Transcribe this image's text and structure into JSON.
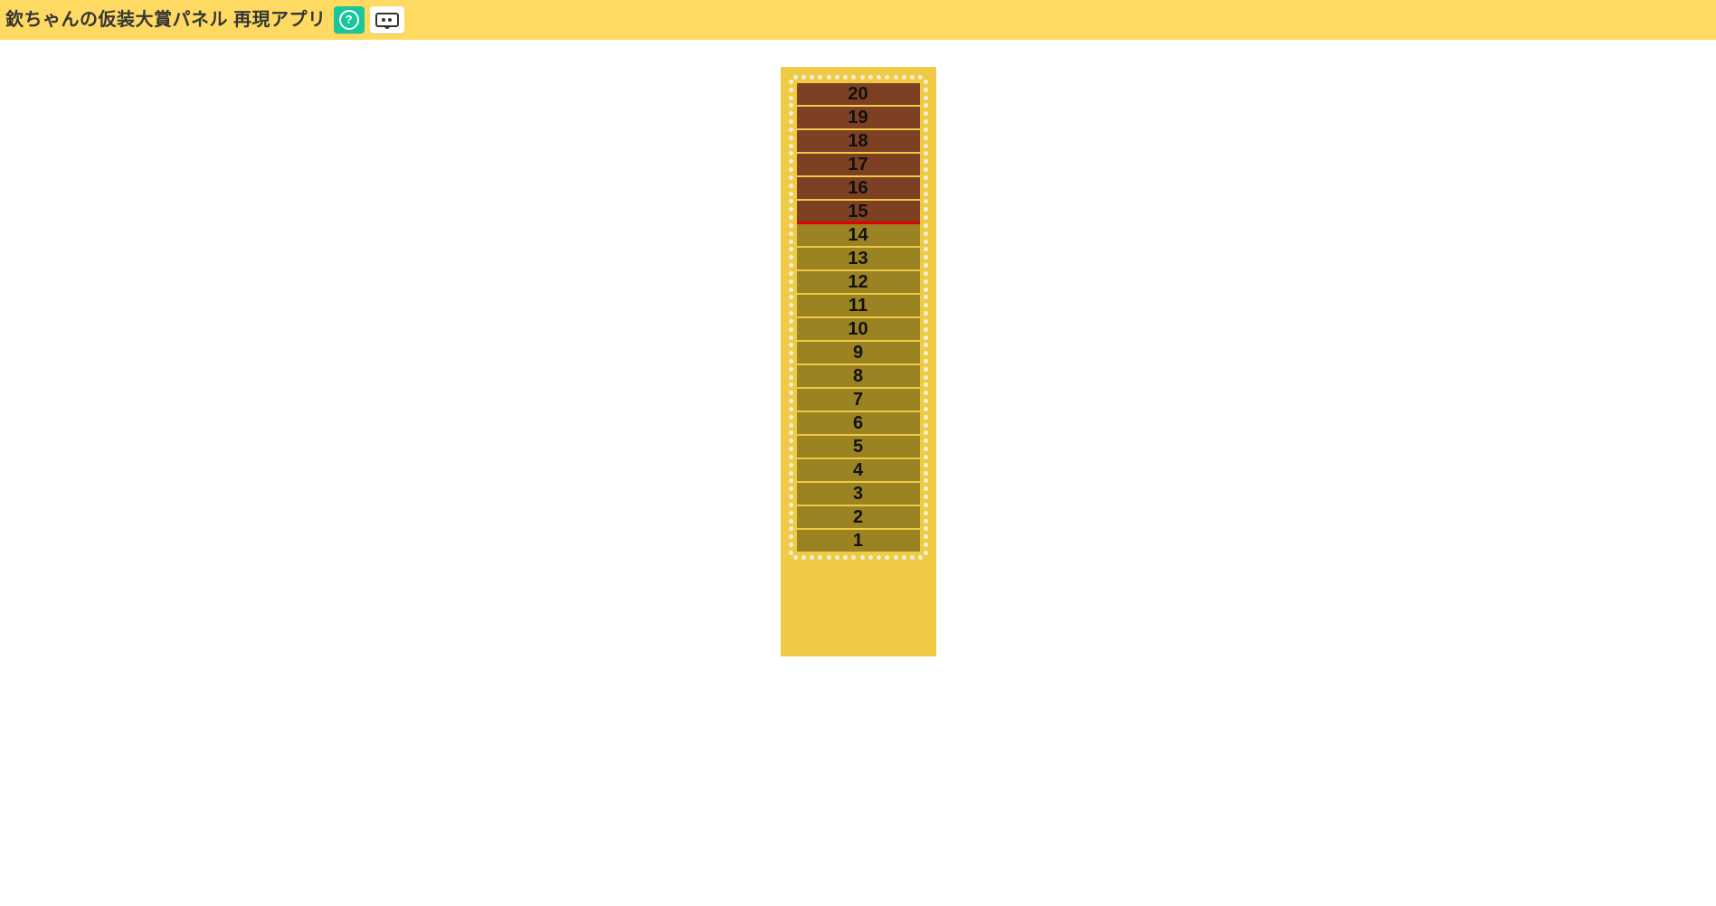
{
  "header": {
    "title": "欽ちゃんの仮装大賞パネル 再現アプリ",
    "help_tooltip": "使い方",
    "vr_tooltip": "コントローラー"
  },
  "panel": {
    "max_score": 20,
    "min_score": 1,
    "threshold_score": 15,
    "bars": [
      {
        "label": "20",
        "state": "high"
      },
      {
        "label": "19",
        "state": "high"
      },
      {
        "label": "18",
        "state": "high"
      },
      {
        "label": "17",
        "state": "high"
      },
      {
        "label": "16",
        "state": "high"
      },
      {
        "label": "15",
        "state": "high",
        "threshold": true
      },
      {
        "label": "14",
        "state": "low"
      },
      {
        "label": "13",
        "state": "low"
      },
      {
        "label": "12",
        "state": "low"
      },
      {
        "label": "11",
        "state": "low"
      },
      {
        "label": "10",
        "state": "low"
      },
      {
        "label": "9",
        "state": "low"
      },
      {
        "label": "8",
        "state": "low"
      },
      {
        "label": "7",
        "state": "low"
      },
      {
        "label": "6",
        "state": "low"
      },
      {
        "label": "5",
        "state": "low"
      },
      {
        "label": "4",
        "state": "low"
      },
      {
        "label": "3",
        "state": "low"
      },
      {
        "label": "2",
        "state": "low"
      },
      {
        "label": "1",
        "state": "low"
      }
    ]
  },
  "colors": {
    "header_bg": "#ffda63",
    "panel_bg": "#efca45",
    "bar_low": "#9b8324",
    "bar_high": "#7e4022",
    "threshold": "#e20000",
    "help_btn": "#16c79a"
  }
}
